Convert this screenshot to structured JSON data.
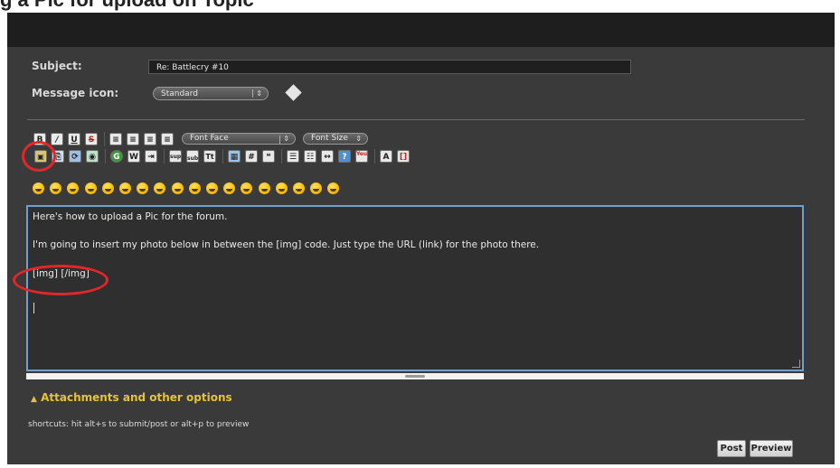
{
  "page_heading": "g a Pic for upload on Topic",
  "form": {
    "subject_label": "Subject:",
    "subject_value": "Re: Battlecry #10",
    "message_icon_label": "Message icon:",
    "message_icon_value": "Standard"
  },
  "toolbar": {
    "font_face_label": "Font Face",
    "font_size_label": "Font Size",
    "bold": "B",
    "underline": "U",
    "strike": "S",
    "google": "G",
    "sup": "sup",
    "sub": "sub",
    "tt": "Tt",
    "hash": "#",
    "youtube": "You"
  },
  "smilies": [
    "smile",
    "grin",
    "happy",
    "laugh",
    "frown",
    "sad",
    "tongue",
    "cool",
    "wink",
    "biggrin",
    "blush",
    "mad",
    "eek",
    "rolleyes",
    "shocked",
    "confused",
    "nerd",
    "angel"
  ],
  "editor": {
    "lines": [
      "Here's how to upload a Pic for the forum.",
      "I'm going to insert my photo below in between the [img] code. Just type the URL (link) for the photo there.",
      "[img] [/img]"
    ]
  },
  "attachments_label": "Attachments and other options",
  "shortcuts_text": "shortcuts: hit alt+s to submit/post or alt+p to preview",
  "buttons": {
    "post": "Post",
    "preview": "Preview"
  },
  "colors": {
    "panel": "#3a3a3a",
    "accent": "#e5c23b",
    "highlight": "#e3262a",
    "editor_border": "#6f9fd0"
  }
}
